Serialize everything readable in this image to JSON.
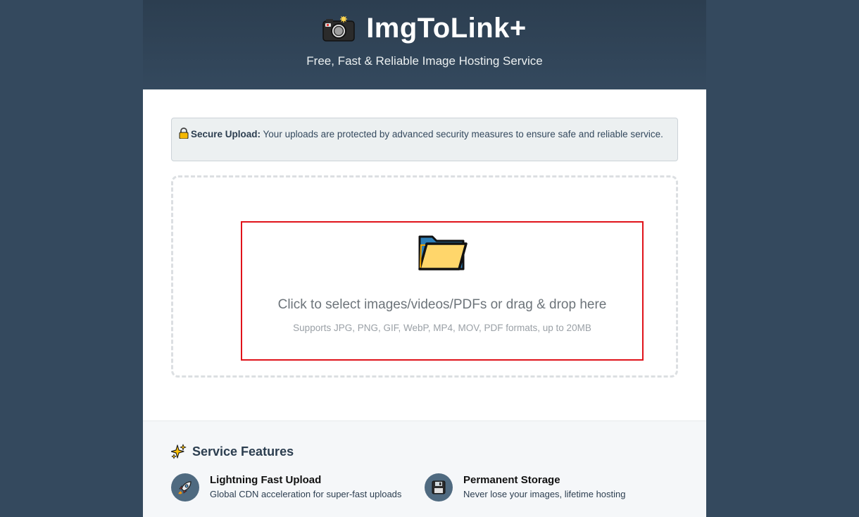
{
  "header": {
    "title": "ImgToLink+",
    "subtitle": "Free, Fast & Reliable Image Hosting Service",
    "logo_icon": "camera-flash-icon"
  },
  "notice": {
    "icon": "lock-icon",
    "label": "Secure Upload:",
    "text": " Your uploads are protected by advanced security measures to ensure safe and reliable service."
  },
  "dropzone": {
    "icon": "folder-icon",
    "title": "Click to select images/videos/PDFs or drag & drop here",
    "hint": "Supports JPG, PNG, GIF, WebP, MP4, MOV, PDF formats, up to 20MB"
  },
  "features": {
    "icon": "sparkles-icon",
    "title": "Service Features",
    "items": [
      {
        "icon": "rocket-icon",
        "name": "Lightning Fast Upload",
        "desc": "Global CDN acceleration for super-fast uploads"
      },
      {
        "icon": "floppy-disk-icon",
        "name": "Permanent Storage",
        "desc": "Never lose your images, lifetime hosting"
      }
    ]
  },
  "colors": {
    "header": "#2c3e50",
    "highlight_border": "#e0131a",
    "feature_icon_bg": "#4f6a80"
  }
}
